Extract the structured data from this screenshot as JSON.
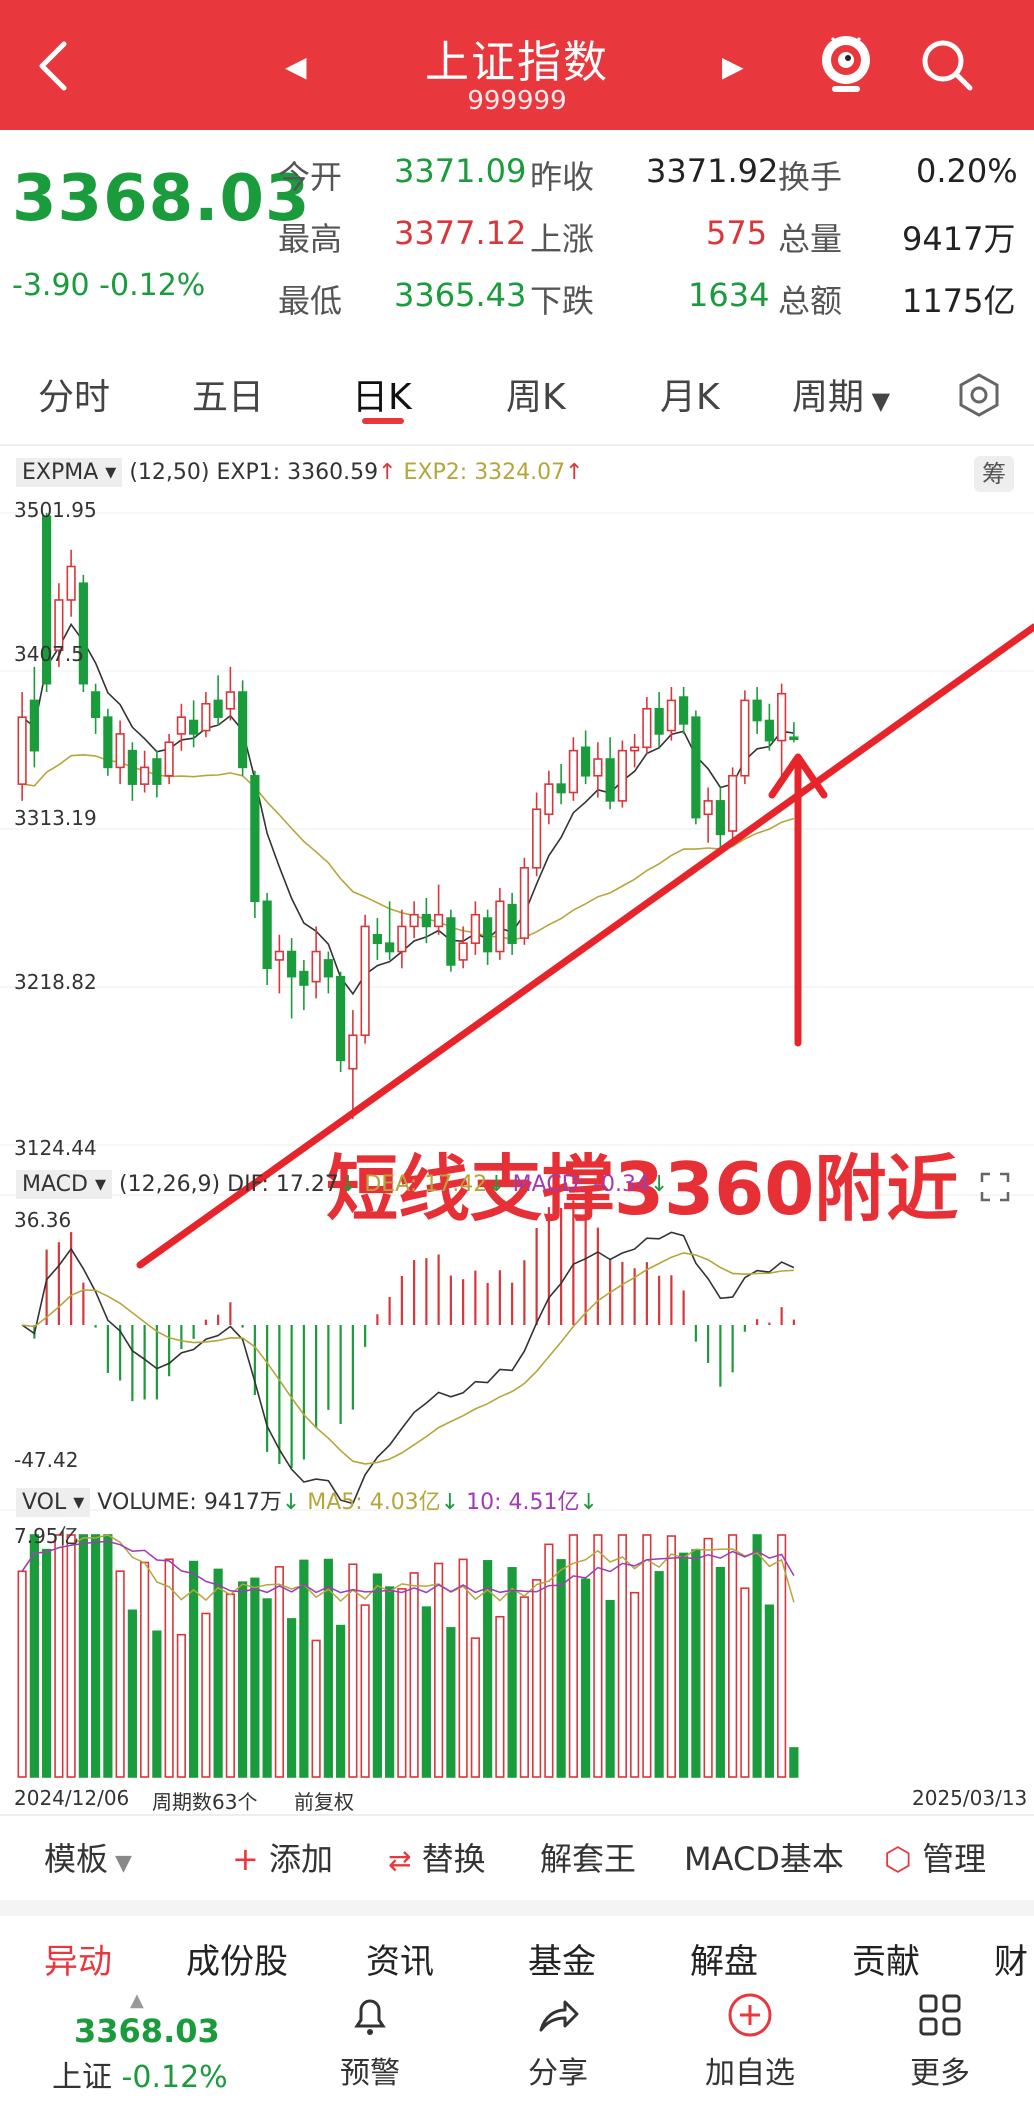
{
  "header": {
    "title": "上证指数",
    "code": "999999",
    "prev_icon": "triangle-left-icon",
    "next_icon": "triangle-right-icon",
    "bg_color": "#e8383d"
  },
  "quote": {
    "price": "3368.03",
    "change": "-3.90",
    "change_pct": "-0.12%",
    "rows": [
      {
        "l1": "今开",
        "v1": "3371.09",
        "l2": "昨收",
        "v2": "3371.92",
        "l3": "换手",
        "v3": "0.20%"
      },
      {
        "l1": "最高",
        "v1": "3377.12",
        "l2": "上涨",
        "v2": "575",
        "l3": "总量",
        "v3": "9417万"
      },
      {
        "l1": "最低",
        "v1": "3365.43",
        "l2": "下跌",
        "v2": "1634",
        "l3": "总额",
        "v3": "1175亿"
      }
    ]
  },
  "tabs": [
    "分时",
    "五日",
    "日K",
    "周K",
    "月K",
    "周期"
  ],
  "active_tab": "日K",
  "kline": {
    "indicator": "EXPMA",
    "params": "(12,50)",
    "exp1": "EXP1: 3360.59",
    "exp2": "EXP2: 3324.07",
    "chip_btn": "筹",
    "y_ticks": [
      "3501.95",
      "3407.5",
      "3313.19",
      "3218.82",
      "3124.44"
    ],
    "annotation": "短线支撑3360附近"
  },
  "macd": {
    "indicator": "MACD",
    "params": "(12,26,9)",
    "dif": "DIF: 17.27",
    "dea": "DEA: 17.42",
    "macd_val": "MACD: -0.34",
    "y_ticks": [
      "36.36",
      "-47.42"
    ]
  },
  "vol": {
    "indicator": "VOL",
    "volume": "VOLUME: 9417万",
    "ma5": "MA5: 4.03亿",
    "ma10": "10: 4.51亿",
    "y_top": "7.95亿",
    "date_start": "2024/12/06",
    "weeks": "周期数63个",
    "adjust": "前复权",
    "date_end": "2025/03/13"
  },
  "toolbar": {
    "template": "模板",
    "add": "添加",
    "replace": "替换",
    "unlock": "解套王",
    "macd_basic": "MACD基本",
    "manage": "管理"
  },
  "bottom_tabs": [
    "异动",
    "成份股",
    "资讯",
    "基金",
    "解盘",
    "贡献",
    "财"
  ],
  "dock": {
    "index_price": "3368.03",
    "index_name": "上证",
    "index_pct": "-0.12%",
    "alert": "预警",
    "share": "分享",
    "watch": "加自选",
    "more": "更多"
  },
  "chart_data": {
    "type": "candlestick",
    "ylim": [
      3124.44,
      3501.95
    ],
    "candles": [
      {
        "o": 3340,
        "c": 3380,
        "h": 3395,
        "l": 3330,
        "up": true
      },
      {
        "o": 3390,
        "c": 3360,
        "h": 3410,
        "l": 3350,
        "up": false
      },
      {
        "o": 3400,
        "c": 3500,
        "h": 3502,
        "l": 3395,
        "up": false
      },
      {
        "o": 3420,
        "c": 3450,
        "h": 3460,
        "l": 3410,
        "up": true
      },
      {
        "o": 3450,
        "c": 3470,
        "h": 3480,
        "l": 3440,
        "up": true
      },
      {
        "o": 3460,
        "c": 3400,
        "h": 3465,
        "l": 3395,
        "up": false
      },
      {
        "o": 3395,
        "c": 3380,
        "h": 3400,
        "l": 3370,
        "up": false
      },
      {
        "o": 3380,
        "c": 3350,
        "h": 3385,
        "l": 3345,
        "up": false
      },
      {
        "o": 3350,
        "c": 3370,
        "h": 3378,
        "l": 3340,
        "up": true
      },
      {
        "o": 3360,
        "c": 3340,
        "h": 3365,
        "l": 3330,
        "up": false
      },
      {
        "o": 3340,
        "c": 3350,
        "h": 3360,
        "l": 3335,
        "up": true
      },
      {
        "o": 3355,
        "c": 3340,
        "h": 3360,
        "l": 3332,
        "up": false
      },
      {
        "o": 3345,
        "c": 3365,
        "h": 3370,
        "l": 3340,
        "up": true
      },
      {
        "o": 3370,
        "c": 3380,
        "h": 3388,
        "l": 3360,
        "up": true
      },
      {
        "o": 3378,
        "c": 3370,
        "h": 3390,
        "l": 3362,
        "up": false
      },
      {
        "o": 3372,
        "c": 3388,
        "h": 3395,
        "l": 3368,
        "up": true
      },
      {
        "o": 3390,
        "c": 3380,
        "h": 3405,
        "l": 3375,
        "up": false
      },
      {
        "o": 3385,
        "c": 3395,
        "h": 3410,
        "l": 3378,
        "up": true
      },
      {
        "o": 3395,
        "c": 3350,
        "h": 3402,
        "l": 3345,
        "up": false
      },
      {
        "o": 3345,
        "c": 3270,
        "h": 3348,
        "l": 3260,
        "up": false
      },
      {
        "o": 3270,
        "c": 3230,
        "h": 3275,
        "l": 3220,
        "up": false
      },
      {
        "o": 3235,
        "c": 3240,
        "h": 3250,
        "l": 3215,
        "up": true
      },
      {
        "o": 3240,
        "c": 3225,
        "h": 3248,
        "l": 3200,
        "up": false
      },
      {
        "o": 3228,
        "c": 3220,
        "h": 3235,
        "l": 3205,
        "up": false
      },
      {
        "o": 3222,
        "c": 3240,
        "h": 3255,
        "l": 3212,
        "up": true
      },
      {
        "o": 3235,
        "c": 3225,
        "h": 3240,
        "l": 3215,
        "up": false
      },
      {
        "o": 3225,
        "c": 3175,
        "h": 3228,
        "l": 3168,
        "up": false
      },
      {
        "o": 3170,
        "c": 3190,
        "h": 3205,
        "l": 3140,
        "up": true
      },
      {
        "o": 3190,
        "c": 3255,
        "h": 3262,
        "l": 3185,
        "up": true
      },
      {
        "o": 3250,
        "c": 3245,
        "h": 3260,
        "l": 3235,
        "up": false
      },
      {
        "o": 3245,
        "c": 3240,
        "h": 3270,
        "l": 3235,
        "up": false
      },
      {
        "o": 3240,
        "c": 3255,
        "h": 3265,
        "l": 3230,
        "up": true
      },
      {
        "o": 3255,
        "c": 3262,
        "h": 3270,
        "l": 3248,
        "up": true
      },
      {
        "o": 3262,
        "c": 3255,
        "h": 3272,
        "l": 3245,
        "up": false
      },
      {
        "o": 3255,
        "c": 3262,
        "h": 3280,
        "l": 3250,
        "up": true
      },
      {
        "o": 3260,
        "c": 3232,
        "h": 3265,
        "l": 3228,
        "up": false
      },
      {
        "o": 3235,
        "c": 3245,
        "h": 3255,
        "l": 3230,
        "up": true
      },
      {
        "o": 3245,
        "c": 3262,
        "h": 3270,
        "l": 3238,
        "up": true
      },
      {
        "o": 3260,
        "c": 3240,
        "h": 3265,
        "l": 3232,
        "up": false
      },
      {
        "o": 3240,
        "c": 3270,
        "h": 3278,
        "l": 3235,
        "up": true
      },
      {
        "o": 3268,
        "c": 3245,
        "h": 3275,
        "l": 3238,
        "up": false
      },
      {
        "o": 3248,
        "c": 3290,
        "h": 3296,
        "l": 3244,
        "up": true
      },
      {
        "o": 3290,
        "c": 3325,
        "h": 3335,
        "l": 3285,
        "up": true
      },
      {
        "o": 3322,
        "c": 3340,
        "h": 3348,
        "l": 3316,
        "up": true
      },
      {
        "o": 3340,
        "c": 3335,
        "h": 3352,
        "l": 3328,
        "up": false
      },
      {
        "o": 3335,
        "c": 3360,
        "h": 3368,
        "l": 3330,
        "up": true
      },
      {
        "o": 3362,
        "c": 3345,
        "h": 3372,
        "l": 3340,
        "up": false
      },
      {
        "o": 3345,
        "c": 3355,
        "h": 3365,
        "l": 3332,
        "up": true
      },
      {
        "o": 3355,
        "c": 3330,
        "h": 3368,
        "l": 3325,
        "up": false
      },
      {
        "o": 3330,
        "c": 3360,
        "h": 3366,
        "l": 3326,
        "up": true
      },
      {
        "o": 3360,
        "c": 3362,
        "h": 3370,
        "l": 3350,
        "up": true
      },
      {
        "o": 3362,
        "c": 3385,
        "h": 3392,
        "l": 3358,
        "up": true
      },
      {
        "o": 3385,
        "c": 3370,
        "h": 3395,
        "l": 3362,
        "up": false
      },
      {
        "o": 3372,
        "c": 3390,
        "h": 3398,
        "l": 3366,
        "up": true
      },
      {
        "o": 3392,
        "c": 3376,
        "h": 3398,
        "l": 3370,
        "up": false
      },
      {
        "o": 3380,
        "c": 3320,
        "h": 3384,
        "l": 3316,
        "up": false
      },
      {
        "o": 3322,
        "c": 3330,
        "h": 3338,
        "l": 3305,
        "up": true
      },
      {
        "o": 3330,
        "c": 3310,
        "h": 3338,
        "l": 3300,
        "up": false
      },
      {
        "o": 3312,
        "c": 3345,
        "h": 3350,
        "l": 3306,
        "up": true
      },
      {
        "o": 3345,
        "c": 3390,
        "h": 3396,
        "l": 3340,
        "up": true
      },
      {
        "o": 3390,
        "c": 3378,
        "h": 3398,
        "l": 3370,
        "up": false
      },
      {
        "o": 3378,
        "c": 3366,
        "h": 3388,
        "l": 3360,
        "up": false
      },
      {
        "o": 3366,
        "c": 3394,
        "h": 3400,
        "l": 3345,
        "up": true
      },
      {
        "o": 3368,
        "c": 3368,
        "h": 3377,
        "l": 3365,
        "up": false
      }
    ],
    "colors": {
      "up": "#d9363b",
      "down": "#1a9b3c",
      "exp1": "#333333",
      "exp2": "#b5a63a"
    }
  }
}
